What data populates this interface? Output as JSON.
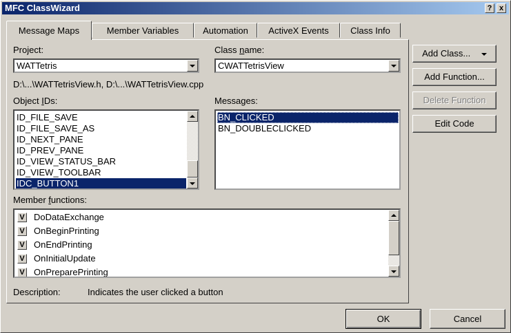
{
  "window": {
    "title": "MFC ClassWizard",
    "help_button": "?",
    "close_button": "x"
  },
  "tabs": [
    {
      "label": "Message Maps",
      "active": true
    },
    {
      "label": "Member Variables",
      "active": false
    },
    {
      "label": "Automation",
      "active": false
    },
    {
      "label": "ActiveX Events",
      "active": false
    },
    {
      "label": "Class Info",
      "active": false
    }
  ],
  "project": {
    "label": "Project:",
    "value": "WATTetris"
  },
  "class_name": {
    "label_pre": "Class ",
    "label_mn": "n",
    "label_post": "ame:",
    "value": "CWATTetrisView"
  },
  "files_path": "D:\\...\\WATTetrisView.h, D:\\...\\WATTetrisView.cpp",
  "object_ids": {
    "label_pre": "Object ",
    "label_mn": "I",
    "label_post": "Ds:",
    "items": [
      "ID_FILE_SAVE",
      "ID_FILE_SAVE_AS",
      "ID_NEXT_PANE",
      "ID_PREV_PANE",
      "ID_VIEW_STATUS_BAR",
      "ID_VIEW_TOOLBAR",
      "IDC_BUTTON1"
    ],
    "selected": "IDC_BUTTON1"
  },
  "messages": {
    "label": "Messages:",
    "items": [
      "BN_CLICKED",
      "BN_DOUBLECLICKED"
    ],
    "selected": "BN_CLICKED"
  },
  "member_functions": {
    "label_pre": "Member ",
    "label_mn": "f",
    "label_post": "unctions:",
    "items": [
      {
        "badge": "V",
        "name": "DoDataExchange"
      },
      {
        "badge": "V",
        "name": "OnBeginPrinting"
      },
      {
        "badge": "V",
        "name": "OnEndPrinting"
      },
      {
        "badge": "V",
        "name": "OnInitialUpdate"
      },
      {
        "badge": "V",
        "name": "OnPreparePrinting"
      }
    ]
  },
  "description": {
    "label": "Description:",
    "text": "Indicates the user clicked a button"
  },
  "buttons": {
    "add_class": "Add Class...",
    "add_function": "Add Function...",
    "delete_function": "Delete Function",
    "edit_code": "Edit Code",
    "ok": "OK",
    "cancel": "Cancel"
  },
  "colors": {
    "face": "#d4d0c8",
    "selection": "#0a246a",
    "title_start": "#0a246a",
    "title_end": "#a6caf0"
  }
}
